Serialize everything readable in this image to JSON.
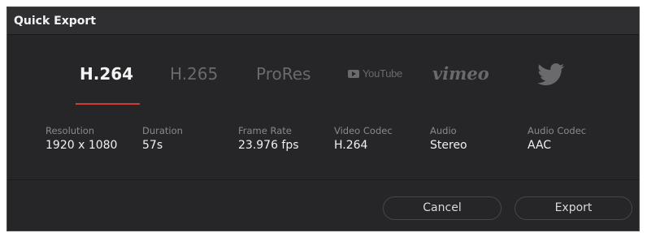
{
  "window": {
    "title": "Quick Export"
  },
  "tabs": [
    {
      "label": "H.264",
      "active": true
    },
    {
      "label": "H.265",
      "active": false
    },
    {
      "label": "ProRes",
      "active": false
    },
    {
      "label": "YouTube",
      "icon": "youtube-play-icon",
      "active": false
    },
    {
      "label": "vimeo",
      "active": false
    },
    {
      "label": "Twitter",
      "icon": "twitter-bird-icon",
      "active": false
    }
  ],
  "info": {
    "resolution": {
      "label": "Resolution",
      "value": "1920 x 1080"
    },
    "duration": {
      "label": "Duration",
      "value": "57s"
    },
    "frame_rate": {
      "label": "Frame Rate",
      "value": "23.976 fps"
    },
    "video_codec": {
      "label": "Video Codec",
      "value": "H.264"
    },
    "audio": {
      "label": "Audio",
      "value": "Stereo"
    },
    "audio_codec": {
      "label": "Audio Codec",
      "value": "AAC"
    }
  },
  "buttons": {
    "cancel": "Cancel",
    "export": "Export"
  },
  "colors": {
    "background": "#262628",
    "active_tab_underline": "#d23a34",
    "inactive_tab": "#6a6a6c",
    "text": "#f0f0f0"
  }
}
